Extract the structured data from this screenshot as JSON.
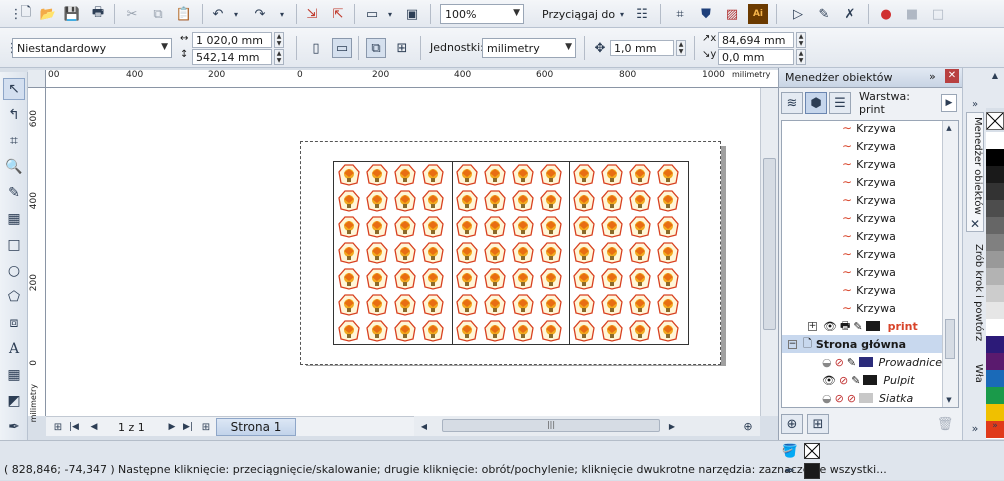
{
  "toolbar": {
    "zoom": "100%",
    "snap_label": "Przyciągaj do"
  },
  "propbar": {
    "paper_size": "Niestandardowy",
    "width": "1 020,0 mm",
    "height": "542,14 mm",
    "units_label": "Jednostki:",
    "units": "milimetry",
    "nudge": "1,0 mm",
    "dup_x": "84,694 mm",
    "dup_y": "0,0 mm"
  },
  "rulers": {
    "h_ticks": [
      "00",
      "400",
      "200",
      "0",
      "200",
      "400",
      "600",
      "800",
      "1000"
    ],
    "h_unit": "milimetry",
    "v_ticks": [
      "600",
      "400",
      "200",
      "0"
    ],
    "v_unit": "milimetry"
  },
  "pages_nav": {
    "counter": "1 z 1",
    "tab": "Strona 1"
  },
  "docker": {
    "title": "Menedżer obiektów",
    "layer_label": "Warstwa:",
    "layer_name": "print",
    "curve_items": [
      "Krzywa",
      "Krzywa",
      "Krzywa",
      "Krzywa",
      "Krzywa",
      "Krzywa",
      "Krzywa",
      "Krzywa",
      "Krzywa",
      "Krzywa",
      "Krzywa"
    ],
    "print_layer": "print",
    "master_page": "Strona główna",
    "master_layers": [
      "Prowadnice",
      "Pulpit",
      "Siatka"
    ]
  },
  "vtabs": {
    "tab1": "Menedżer obiektów",
    "tab2": "Zrób krok i powtórz",
    "tab3": "Wła"
  },
  "status": {
    "coords": "( 828,846; -74,347 )",
    "hint": "Następne kliknięcie: przeciągnięcie/skalowanie; drugie kliknięcie: obrót/pochylenie; kliknięcie dwukrotne narzędzia: zaznaczenie wszystki..."
  },
  "palette": [
    "#ffffff",
    "#000000",
    "#1a1a1a",
    "#333333",
    "#4d4d4d",
    "#666666",
    "#808080",
    "#999999",
    "#b3b3b3",
    "#cccccc",
    "#e6e6e6",
    "#ffffff",
    "#2c1a78",
    "#5a1a6e",
    "#1a6ab8",
    "#1a9a4a",
    "#f0c000",
    "#e03a1a"
  ],
  "colors": {
    "accent": "#d8442a",
    "selection_blue": "#c8d8ee"
  }
}
